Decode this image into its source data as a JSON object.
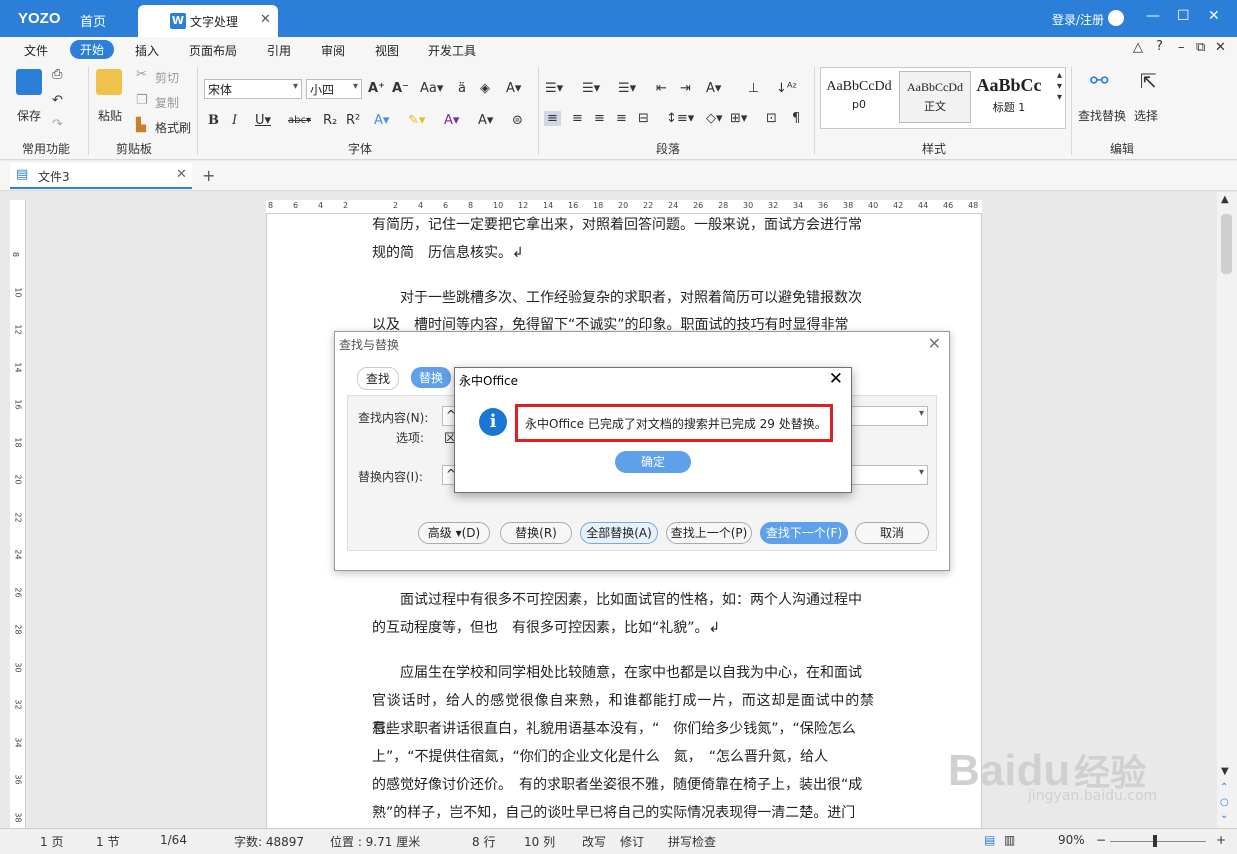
{
  "app": {
    "logo": "YOZO",
    "home": "首页",
    "tab": "文字处理",
    "login": "登录/注册"
  },
  "menu": [
    "文件",
    "开始",
    "插入",
    "页面布局",
    "引用",
    "审阅",
    "视图",
    "开发工具"
  ],
  "ribbon": {
    "save": "保存",
    "paste": "粘贴",
    "cut": "剪切",
    "copy": "复制",
    "format_painter": "格式刷",
    "font_name": "宋体",
    "font_size": "小四",
    "styles": [
      {
        "sample": "AaBbCcDd",
        "name": "p0"
      },
      {
        "sample": "AaBbCcDd",
        "name": "正文"
      },
      {
        "sample": "AaBbCc",
        "name": "标题 1"
      }
    ],
    "find_replace": "查找替换",
    "select": "选择",
    "groups": [
      "常用功能",
      "剪贴板",
      "字体",
      "段落",
      "样式",
      "编辑"
    ]
  },
  "doc_tab": "文件3",
  "ruler_h": [
    "8",
    "6",
    "4",
    "2",
    "",
    "2",
    "4",
    "6",
    "8",
    "10",
    "12",
    "14",
    "16",
    "18",
    "20",
    "22",
    "24",
    "26",
    "28",
    "30",
    "32",
    "34",
    "36",
    "38",
    "40",
    "42",
    "44",
    "46",
    "48"
  ],
  "ruler_v": [
    "8",
    "10",
    "12",
    "14",
    "16",
    "18",
    "20",
    "22",
    "24",
    "26",
    "28",
    "30",
    "32",
    "34",
    "36",
    "38"
  ],
  "paragraphs": [
    "有简历，记住一定要把它拿出来，对照着回答问题。一般来说，面试方会进行常",
    "规的简　历信息核实。↲",
    "　　对于一些跳槽多次、工作经验复杂的求职者，对照着简历可以避免错报数次",
    "以及　槽时间等内容，免得留下“不诚实”的印象。职面试的技巧有时显得非常",
    "　　面试过程中有很多不可控因素，比如面试官的性格，如：两个人沟通过程中",
    "的互动程度等，但也　有很多可控因素，比如“礼貌”。↲",
    "　　应届生在学校和同学相处比较随意，在家中也都是以自我为中心，在和面试",
    "官谈话时，给人的感觉很像自来熟，和谁都能打成一片，而这却是面试中的禁忌。",
    "有些求职者讲话很直白，礼貌用语基本没有，“　你们给多少钱氮”，“保险怎么",
    "上”，“不提供住宿氮，“你们的企业文化是什么　氮，　“怎么晋升氮，给人",
    "的感觉好像讨价还价。　有的求职者坐姿很不雅，随便倚靠在椅子上，装出很“成",
    "熟”的样子，岂不知，自己的谈吐早已将自己的实际情况表现得一清二楚。进门"
  ],
  "find_dialog": {
    "title": "查找与替换",
    "tab_find": "查找",
    "tab_replace": "替换",
    "find_label": "查找内容(N):",
    "options_label": "选项:",
    "replace_label": "替换内容(I):",
    "find_value": "^",
    "replace_value": "^",
    "options_value": "区",
    "buttons": [
      "高级 ▾(D)",
      "替换(R)",
      "全部替换(A)",
      "查找上一个(P)",
      "查找下一个(F)",
      "取消"
    ]
  },
  "msgbox": {
    "title": "永中Office",
    "text": "永中Office 已完成了对文档的搜索并已完成 29 处替换。",
    "ok": "确定"
  },
  "status": {
    "page": "1 页",
    "section": "1 节",
    "pages": "1/64",
    "words": "字数: 48897",
    "position": "位置 : 9.71 厘米",
    "line": "8 行",
    "col": "10 列",
    "track": "改写",
    "revise": "修订",
    "spell": "拼写检查",
    "zoom": "90%"
  },
  "watermark": {
    "brand": "Bai",
    "brand2": "du",
    "sub": "经验",
    "url": "jingyan.baidu.com"
  }
}
